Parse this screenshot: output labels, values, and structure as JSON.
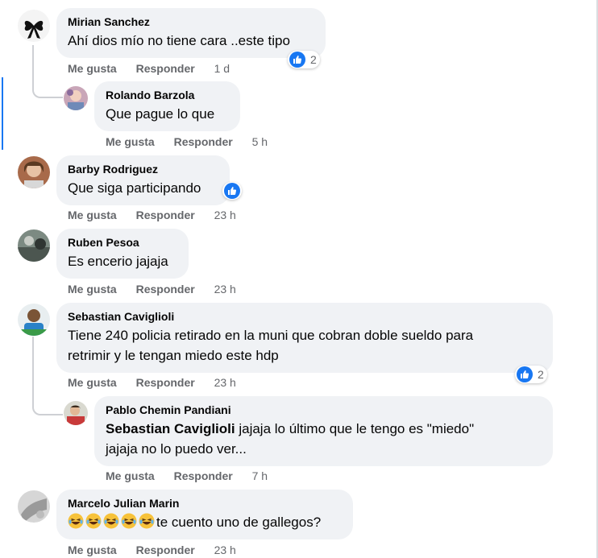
{
  "labels": {
    "like": "Me gusta",
    "reply": "Responder"
  },
  "comments": [
    {
      "author": "Mirian Sanchez",
      "text": "Ahí dios mío no tiene cara ..este tipo",
      "time": "1 d",
      "reaction_count": "2",
      "reaction_icon": "like-icon"
    },
    {
      "author": "Rolando Barzola",
      "text": "Que pague lo que",
      "time": "5 h"
    },
    {
      "author": "Barby Rodriguez",
      "text": "Que siga participando",
      "time": "23 h",
      "reaction_icon": "like-icon"
    },
    {
      "author": "Ruben Pesoa",
      "text": "Es encerio jajaja",
      "time": "23 h"
    },
    {
      "author": "Sebastian Caviglioli",
      "text_line1": "Tiene 240 policia retirado en la muni que cobran doble sueldo para",
      "text_line2": "retrimir y le tengan miedo este hdp",
      "time": "23 h",
      "reaction_count": "2",
      "reaction_icon": "like-icon"
    },
    {
      "author": "Pablo Chemin Pandiani",
      "mention": "Sebastian Caviglioli",
      "text_line1": " jajaja lo último que le tengo es \"miedo\"",
      "text_line2": "jajaja no lo puedo ver...",
      "time": "7 h"
    },
    {
      "author": "Marcelo Julian Marin",
      "emoji_count": 5,
      "emoji_icon": "laughing-emoji-icon",
      "text": "te cuento uno de gallegos?",
      "time": "23 h"
    }
  ],
  "colors": {
    "bubble": "#f0f2f5",
    "accent": "#1877f2",
    "meta": "#65676b"
  }
}
